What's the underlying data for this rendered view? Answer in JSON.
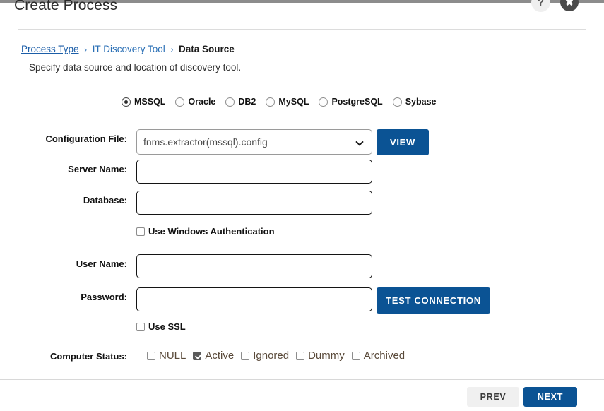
{
  "header": {
    "title": "Create Process",
    "help_icon": "question-mark-icon",
    "help_label": "?",
    "close_label": "✖"
  },
  "breadcrumb": {
    "items": [
      {
        "label": "Process Type",
        "state": "link-underlined"
      },
      {
        "label": "IT Discovery Tool",
        "state": "link"
      },
      {
        "label": "Data Source",
        "state": "current"
      }
    ],
    "separator": "›"
  },
  "subtitle": "Specify data source and location of discovery tool.",
  "database_types": {
    "selected": "MSSQL",
    "options": [
      {
        "label": "MSSQL",
        "checked": true
      },
      {
        "label": "Oracle",
        "checked": false
      },
      {
        "label": "DB2",
        "checked": false
      },
      {
        "label": "MySQL",
        "checked": false
      },
      {
        "label": "PostgreSQL",
        "checked": false
      },
      {
        "label": "Sybase",
        "checked": false
      }
    ]
  },
  "form": {
    "config_file": {
      "label": "Configuration File:",
      "value": "fnms.extractor(mssql).config",
      "view_button": "VIEW"
    },
    "server_name": {
      "label": "Server Name:",
      "value": "",
      "placeholder": ""
    },
    "database": {
      "label": "Database:",
      "value": "",
      "placeholder": ""
    },
    "use_windows_auth": {
      "label": "Use Windows Authentication",
      "checked": false
    },
    "user_name": {
      "label": "User Name:",
      "value": "",
      "placeholder": ""
    },
    "password": {
      "label": "Password:",
      "value": "",
      "placeholder": ""
    },
    "test_connection_button": "TEST CONNECTION",
    "use_ssl": {
      "label": "Use SSL",
      "checked": false
    },
    "computer_status": {
      "label": "Computer Status:",
      "options": [
        {
          "label": "NULL",
          "checked": false
        },
        {
          "label": "Active",
          "checked": true
        },
        {
          "label": "Ignored",
          "checked": false
        },
        {
          "label": "Dummy",
          "checked": false
        },
        {
          "label": "Archived",
          "checked": false
        }
      ]
    }
  },
  "footer": {
    "prev_label": "PREV",
    "next_label": "NEXT"
  },
  "colors": {
    "accent_blue": "#0b5394",
    "link_blue": "#1c5ea8",
    "status_label": "#5a4a3a",
    "checked_box": "#5b5b5b"
  }
}
